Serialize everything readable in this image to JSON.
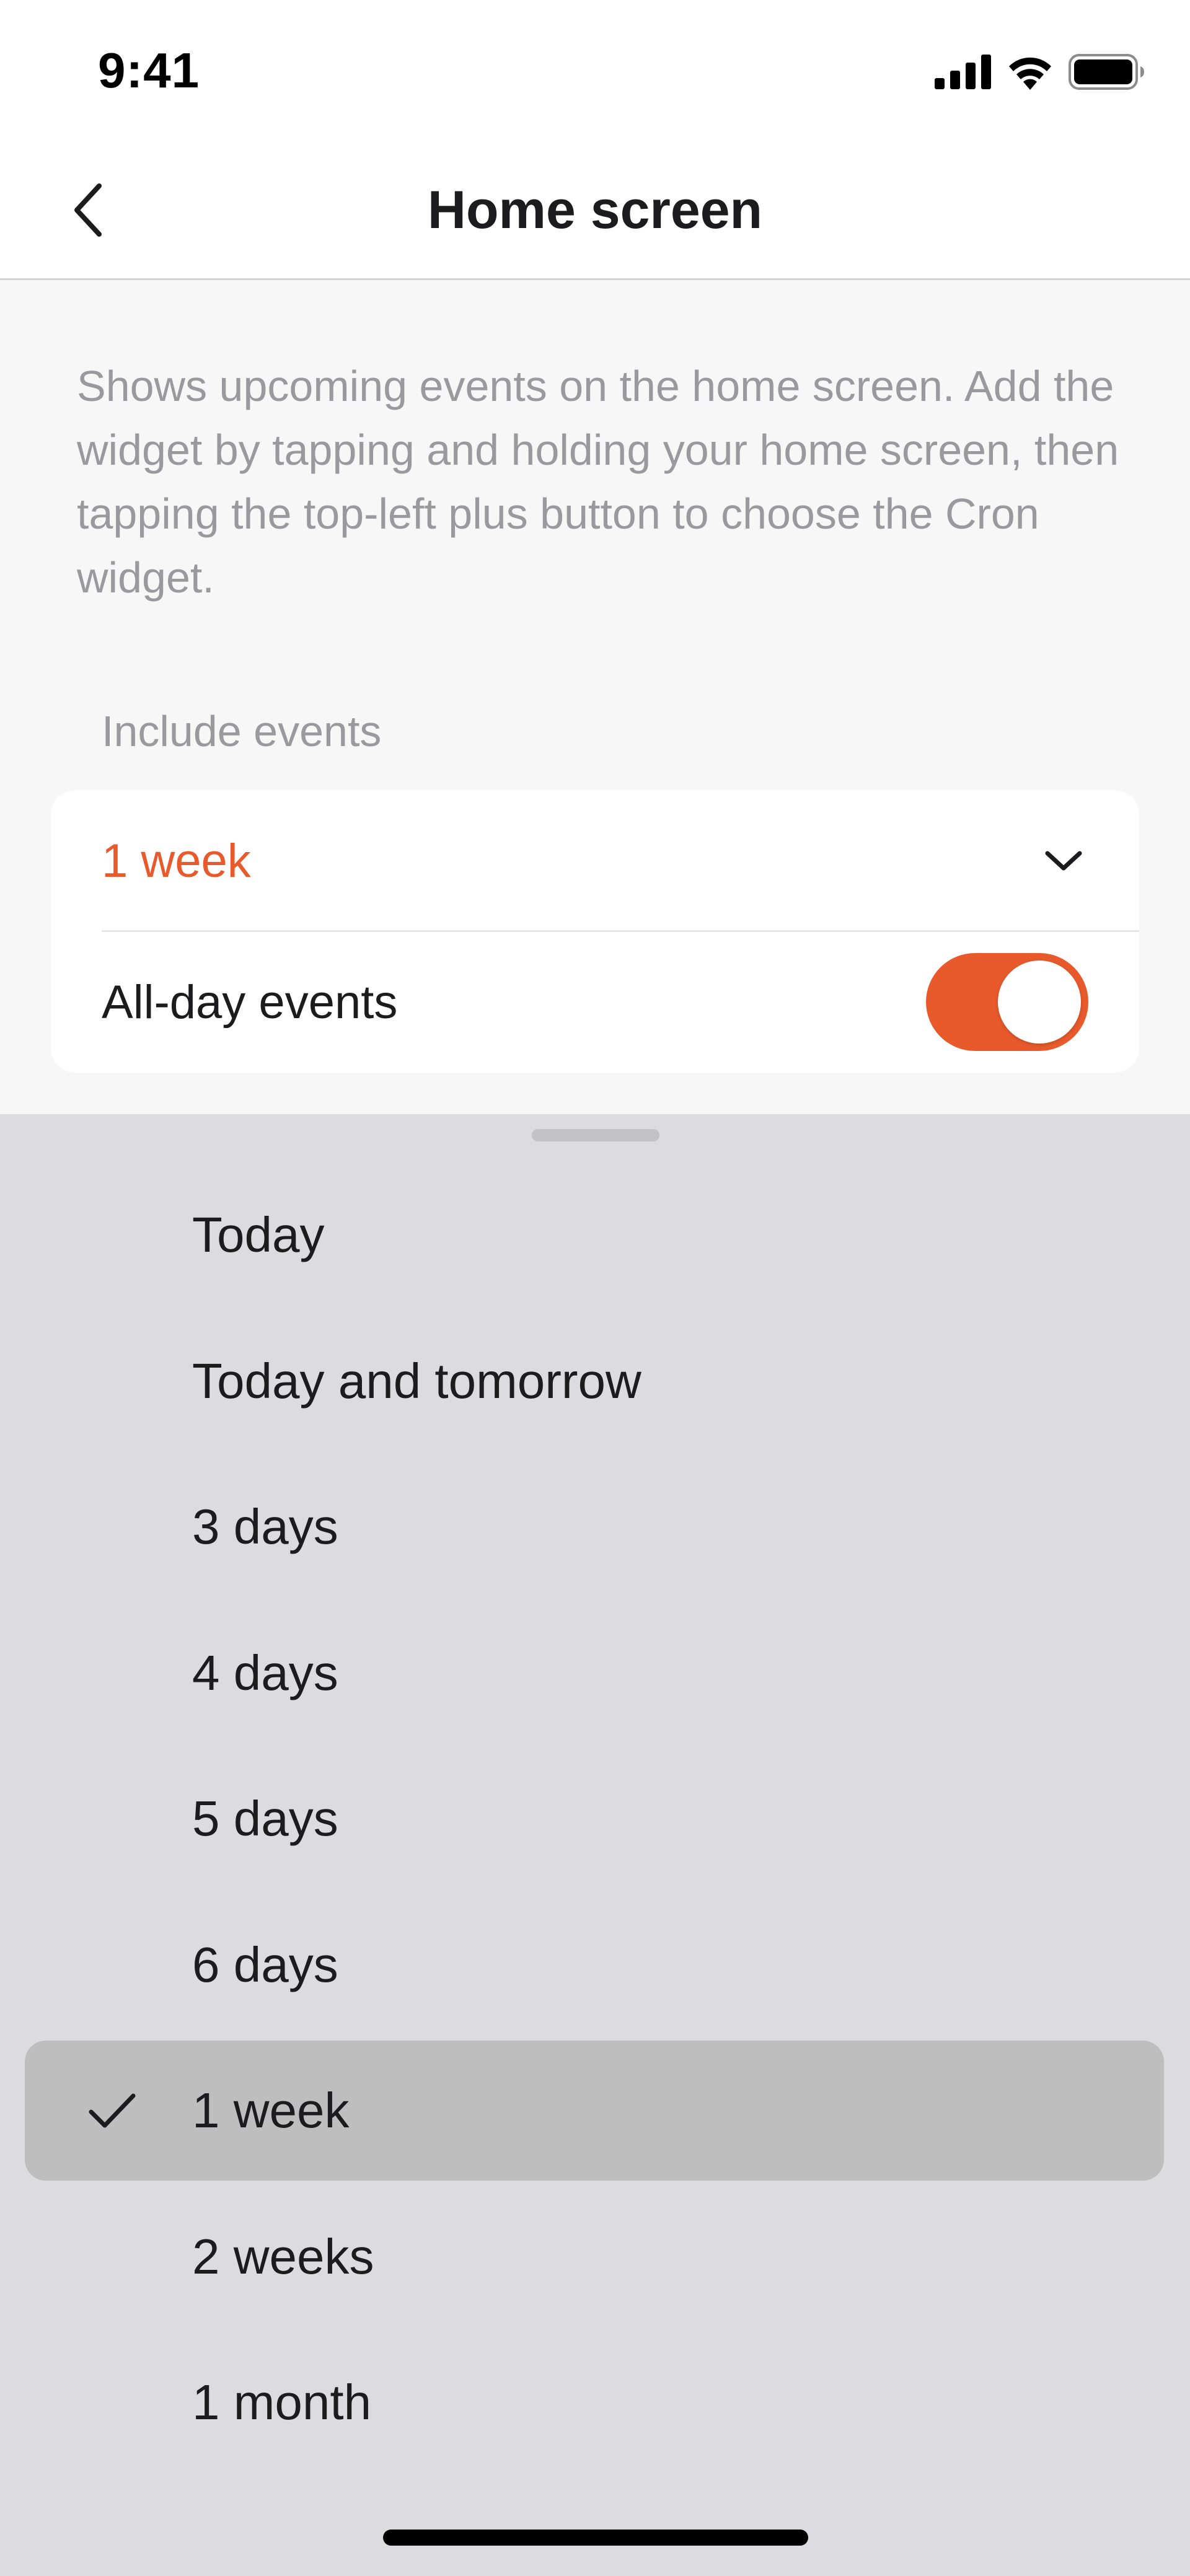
{
  "status_bar": {
    "time": "9:41",
    "icons": [
      "cellular-signal-icon",
      "wifi-icon",
      "battery-icon"
    ]
  },
  "nav": {
    "title": "Home screen",
    "back_icon": "chevron-left-icon"
  },
  "description": "Shows upcoming events on the home screen. Add the widget by tapping and holding your home screen, then tapping the top-left plus button to choose the Cron widget.",
  "settings": {
    "section_label": "Include events",
    "range_value": "1 week",
    "all_day_label": "All-day events",
    "all_day_enabled": true
  },
  "sheet": {
    "options": [
      {
        "label": "Today",
        "selected": false
      },
      {
        "label": "Today and tomorrow",
        "selected": false
      },
      {
        "label": "3 days",
        "selected": false
      },
      {
        "label": "4 days",
        "selected": false
      },
      {
        "label": "5 days",
        "selected": false
      },
      {
        "label": "6 days",
        "selected": false
      },
      {
        "label": "1 week",
        "selected": true
      },
      {
        "label": "2 weeks",
        "selected": false
      },
      {
        "label": "1 month",
        "selected": false
      }
    ]
  },
  "colors": {
    "accent": "#e85a2c",
    "sheet_background": "#dbdbe0",
    "selected_row": "#bebebe",
    "secondary_text": "#9a9a9e"
  }
}
